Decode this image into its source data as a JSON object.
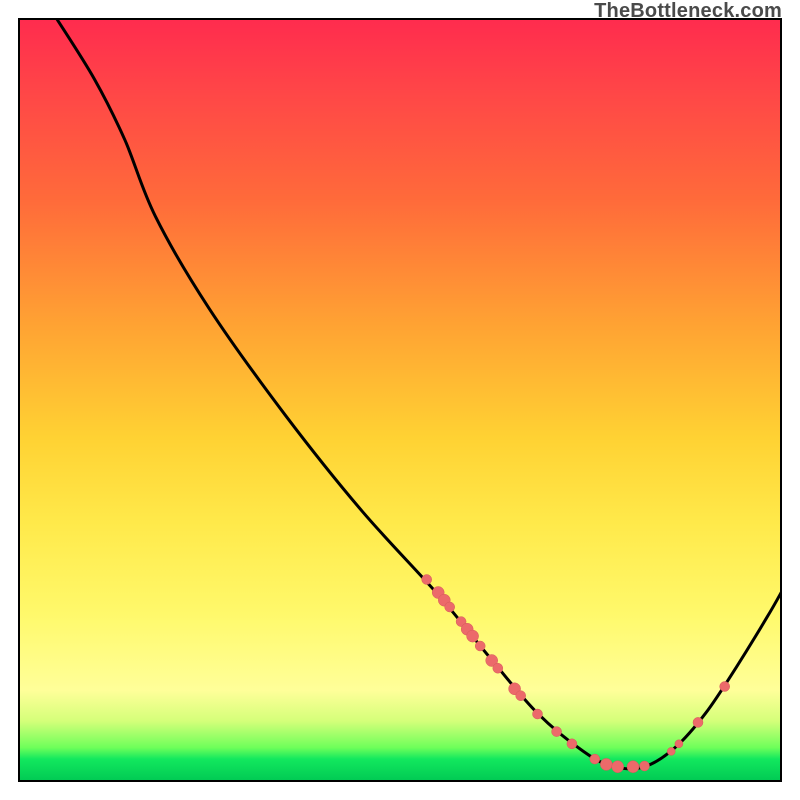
{
  "watermark": "TheBottleneck.com",
  "chart_data": {
    "type": "line",
    "title": "",
    "xlabel": "",
    "ylabel": "",
    "x_range": [
      0,
      100
    ],
    "y_range": [
      0,
      100
    ],
    "curve": [
      {
        "x": 5.0,
        "y": 100.0
      },
      {
        "x": 10.0,
        "y": 92.0
      },
      {
        "x": 14.0,
        "y": 84.0
      },
      {
        "x": 18.0,
        "y": 74.0
      },
      {
        "x": 25.0,
        "y": 62.0
      },
      {
        "x": 35.0,
        "y": 48.0
      },
      {
        "x": 45.0,
        "y": 35.5
      },
      {
        "x": 55.0,
        "y": 24.5
      },
      {
        "x": 62.0,
        "y": 16.0
      },
      {
        "x": 68.0,
        "y": 9.0
      },
      {
        "x": 74.0,
        "y": 4.0
      },
      {
        "x": 78.0,
        "y": 2.0
      },
      {
        "x": 82.0,
        "y": 2.0
      },
      {
        "x": 86.0,
        "y": 4.5
      },
      {
        "x": 90.0,
        "y": 9.0
      },
      {
        "x": 94.0,
        "y": 15.0
      },
      {
        "x": 98.0,
        "y": 21.5
      },
      {
        "x": 100.0,
        "y": 25.0
      }
    ],
    "markers": [
      {
        "x": 53.5,
        "y": 26.5,
        "r": 5
      },
      {
        "x": 55.0,
        "y": 24.8,
        "r": 6
      },
      {
        "x": 55.8,
        "y": 23.8,
        "r": 6
      },
      {
        "x": 56.5,
        "y": 22.9,
        "r": 5
      },
      {
        "x": 58.0,
        "y": 21.0,
        "r": 5
      },
      {
        "x": 58.8,
        "y": 20.0,
        "r": 6
      },
      {
        "x": 59.5,
        "y": 19.1,
        "r": 6
      },
      {
        "x": 60.5,
        "y": 17.8,
        "r": 5
      },
      {
        "x": 62.0,
        "y": 15.9,
        "r": 6
      },
      {
        "x": 62.8,
        "y": 14.9,
        "r": 5
      },
      {
        "x": 65.0,
        "y": 12.2,
        "r": 6
      },
      {
        "x": 65.8,
        "y": 11.3,
        "r": 5
      },
      {
        "x": 68.0,
        "y": 8.9,
        "r": 5
      },
      {
        "x": 70.5,
        "y": 6.6,
        "r": 5
      },
      {
        "x": 72.5,
        "y": 5.0,
        "r": 5
      },
      {
        "x": 75.5,
        "y": 3.0,
        "r": 5
      },
      {
        "x": 77.0,
        "y": 2.3,
        "r": 6
      },
      {
        "x": 78.5,
        "y": 2.0,
        "r": 6
      },
      {
        "x": 80.5,
        "y": 2.0,
        "r": 6
      },
      {
        "x": 82.0,
        "y": 2.1,
        "r": 5
      },
      {
        "x": 85.5,
        "y": 4.0,
        "r": 4
      },
      {
        "x": 86.5,
        "y": 5.0,
        "r": 4
      },
      {
        "x": 89.0,
        "y": 7.8,
        "r": 5
      },
      {
        "x": 92.5,
        "y": 12.5,
        "r": 5
      }
    ],
    "colors": {
      "curve": "#000000",
      "marker_fill": "#ec6a6a",
      "marker_stroke": "#d65a5a"
    }
  }
}
